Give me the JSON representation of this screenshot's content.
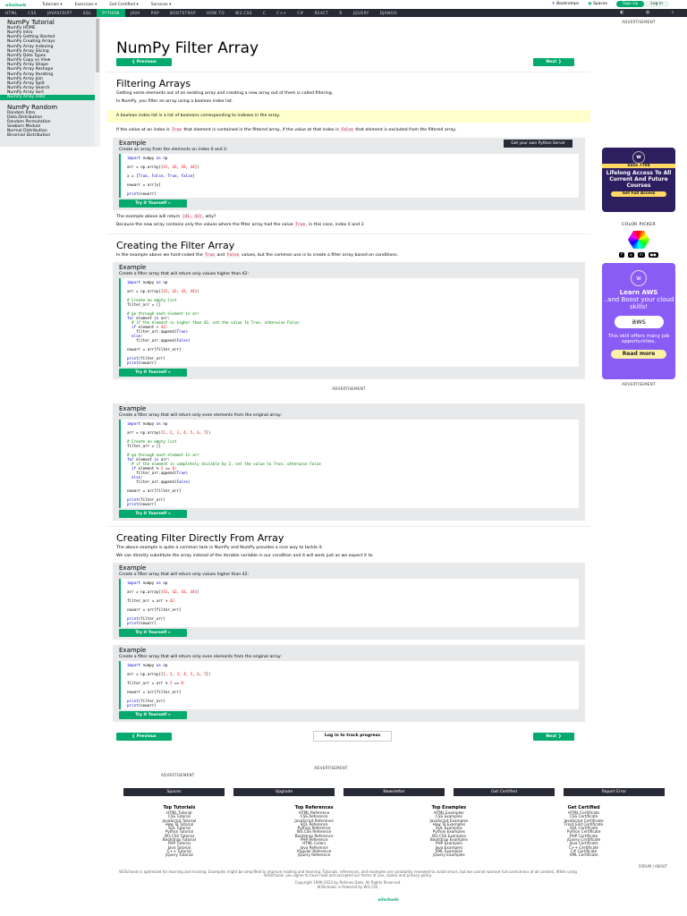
{
  "topbar": {
    "logo": "w3schools",
    "menus": [
      "Tutorials ▾",
      "Exercises ▾",
      "Get Certified ▾",
      "Services ▾"
    ],
    "bootcamps": "Bootcamps",
    "spaces": "Spaces",
    "signup": "Sign Up",
    "login": "Log in"
  },
  "nav": {
    "items": [
      "HTML",
      "CSS",
      "JAVASCRIPT",
      "SQL",
      "PYTHON",
      "JAVA",
      "PHP",
      "BOOTSTRAP",
      "HOW TO",
      "W3.CSS",
      "C",
      "C++",
      "C#",
      "REACT",
      "R",
      "JQUERY",
      "DJANGO"
    ],
    "active": "PYTHON"
  },
  "sidebar": {
    "tutorial_heading": "NumPy Tutorial",
    "tutorial_items": [
      "NumPy HOME",
      "NumPy Intro",
      "NumPy Getting Started",
      "NumPy Creating Arrays",
      "NumPy Array Indexing",
      "NumPy Array Slicing",
      "NumPy Data Types",
      "NumPy Copy vs View",
      "NumPy Array Shape",
      "NumPy Array Reshape",
      "NumPy Array Iterating",
      "NumPy Array Join",
      "NumPy Array Split",
      "NumPy Array Search",
      "NumPy Array Sort",
      "NumPy Array Filter"
    ],
    "active": "NumPy Array Filter",
    "random_heading": "NumPy Random",
    "random_items": [
      "Random Intro",
      "Data Distribution",
      "Random Permutation",
      "Seaborn Module",
      "Normal Distribution",
      "Binomial Distribution"
    ]
  },
  "main": {
    "title": "NumPy Filter Array",
    "prev": "❮ Previous",
    "next": "Next ❯",
    "h_filtering": "Filtering Arrays",
    "p1": "Getting some elements out of an existing array and creating a new array out of them is called filtering.",
    "p2": "In NumPy, you filter an array using a boolean index list.",
    "note": "A boolean index list is a list of booleans corresponding to indexes in the array.",
    "p3a": "If the value at an index is",
    "true": "True",
    "p3b": "that element is contained in the filtered array, if the value at that index is",
    "false": "False",
    "p3c": "that element is excluded from the filtered array.",
    "example_label": "Example",
    "server_btn": "Get your own Python Server",
    "try_btn": "Try it Yourself »",
    "ex1": {
      "desc": "Create an array from the elements on index 0 and 2:",
      "code": [
        "import numpy as np",
        "",
        "arr = np.array([41, 42, 43, 44])",
        "",
        "x = [True, False, True, False]",
        "",
        "newarr = arr[x]",
        "",
        "print(newarr)"
      ]
    },
    "p4a": "The example above will return",
    "p4code": "[41, 43]",
    "p4b": ", why?",
    "p5a": "Because the new array contains only the values where the filter array had the value",
    "p5b": ", in this case, index 0 and 2.",
    "h_creating": "Creating the Filter Array",
    "p6a": "In the example above we hard-coded the",
    "p6b": "and",
    "p6c": "values, but the common use is to create a filter array based on conditions.",
    "ex2": {
      "desc": "Create a filter array that will return only values higher than 42:",
      "code": [
        "import numpy as np",
        "",
        "arr = np.array([41, 42, 43, 44])",
        "",
        "# Create an empty list",
        "filter_arr = []",
        "",
        "# go through each element in arr",
        "for element in arr:",
        "  # if the element is higher than 42, set the value to True, otherwise False:",
        "  if element > 42:",
        "    filter_arr.append(True)",
        "  else:",
        "    filter_arr.append(False)",
        "",
        "newarr = arr[filter_arr]",
        "",
        "print(filter_arr)",
        "print(newarr)"
      ]
    },
    "advertisement": "ADVERTISEMENT",
    "ex3": {
      "desc": "Create a filter array that will return only even elements from the original array:",
      "code": [
        "import numpy as np",
        "",
        "arr = np.array([1, 2, 3, 4, 5, 6, 7])",
        "",
        "# Create an empty list",
        "filter_arr = []",
        "",
        "# go through each element in arr",
        "for element in arr:",
        "  # if the element is completely divisble by 2, set the value to True, otherwise False",
        "  if element % 2 == 0:",
        "    filter_arr.append(True)",
        "  else:",
        "    filter_arr.append(False)",
        "",
        "newarr = arr[filter_arr]",
        "",
        "print(filter_arr)",
        "print(newarr)"
      ]
    },
    "h_direct": "Creating Filter Directly From Array",
    "p7": "The above example is quite a common task in NumPy and NumPy provides a nice way to tackle it.",
    "p8": "We can directly substitute the array instead of the iterable variable in our condition and it will work just as we expect it to.",
    "ex4": {
      "desc": "Create a filter array that will return only values higher than 42:",
      "code": [
        "import numpy as np",
        "",
        "arr = np.array([41, 42, 43, 44])",
        "",
        "filter_arr = arr > 42",
        "",
        "newarr = arr[filter_arr]",
        "",
        "print(filter_arr)",
        "print(newarr)"
      ]
    },
    "ex5": {
      "desc": "Create a filter array that will return only even elements from the original array:",
      "code": [
        "import numpy as np",
        "",
        "arr = np.array([1, 2, 3, 4, 5, 6, 7])",
        "",
        "filter_arr = arr % 2 == 0",
        "",
        "newarr = arr[filter_arr]",
        "",
        "print(filter_arr)",
        "print(newarr)"
      ]
    },
    "track": "Log in to track progress"
  },
  "right": {
    "ad1_save": "Save 770$",
    "ad1_text": "Lifelong Access To All Current And Future Courses",
    "ad1_cta": "Get Full Access",
    "color_picker": "COLOR PICKER",
    "social": [
      "f",
      "◎",
      "in",
      "●●"
    ],
    "ad2_title": "Learn AWS",
    "ad2_sub": "..and Boost your cloud skills!",
    "ad2_aws": "aws",
    "ad2_body": "This skill offers many job opportunities.",
    "ad2_cta": "Read more",
    "advertisement": "ADVERTISEMENT"
  },
  "footer": {
    "ad1": "ADVERTISEMENT",
    "ad2": "ADVERTISEMENT",
    "buttons": [
      "Spaces",
      "Upgrade",
      "Newsletter",
      "Get Certified",
      "Report Error"
    ],
    "columns": [
      {
        "title": "Top Tutorials",
        "items": [
          "HTML Tutorial",
          "CSS Tutorial",
          "JavaScript Tutorial",
          "How To Tutorial",
          "SQL Tutorial",
          "Python Tutorial",
          "W3.CSS Tutorial",
          "Bootstrap Tutorial",
          "PHP Tutorial",
          "Java Tutorial",
          "C++ Tutorial",
          "jQuery Tutorial"
        ]
      },
      {
        "title": "Top References",
        "items": [
          "HTML Reference",
          "CSS Reference",
          "JavaScript Reference",
          "SQL Reference",
          "Python Reference",
          "W3.CSS Reference",
          "Bootstrap Reference",
          "PHP Reference",
          "HTML Colors",
          "Java Reference",
          "Angular Reference",
          "jQuery Reference"
        ]
      },
      {
        "title": "Top Examples",
        "items": [
          "HTML Examples",
          "CSS Examples",
          "JavaScript Examples",
          "How To Examples",
          "SQL Examples",
          "Python Examples",
          "W3.CSS Examples",
          "Bootstrap Examples",
          "PHP Examples",
          "Java Examples",
          "XML Examples",
          "jQuery Examples"
        ]
      },
      {
        "title": "Get Certified",
        "items": [
          "HTML Certificate",
          "CSS Certificate",
          "JavaScript Certificate",
          "Front End Certificate",
          "SQL Certificate",
          "Python Certificate",
          "PHP Certificate",
          "jQuery Certificate",
          "Java Certificate",
          "C++ Certificate",
          "C# Certificate",
          "XML Certificate"
        ]
      }
    ],
    "forum_about": "FORUM | ABOUT",
    "disclaimer": "W3Schools is optimized for learning and training. Examples might be simplified to improve reading and learning. Tutorials, references, and examples are constantly reviewed to avoid errors, but we cannot warrant full correctness of all content. While using W3Schools, you agree to have read and accepted our terms of use, cookie and privacy policy.",
    "copyright": "Copyright 1999-2023 by Refsnes Data. All Rights Reserved.",
    "powered": "W3Schools is Powered by W3.CSS.",
    "logo": "w3schools"
  }
}
